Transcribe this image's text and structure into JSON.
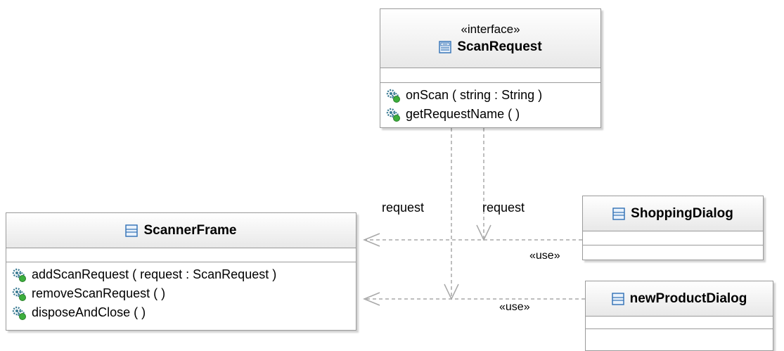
{
  "diagram": {
    "interface": {
      "stereotype": "«interface»",
      "name": "ScanRequest",
      "icon": "interface-icon",
      "operations": [
        "onScan ( string : String )",
        "getRequestName ( )"
      ]
    },
    "scanner_frame": {
      "name": "ScannerFrame",
      "icon": "class-icon",
      "operations": [
        "addScanRequest ( request : ScanRequest )",
        "removeScanRequest ( )",
        "disposeAndClose ( )"
      ]
    },
    "shopping_dialog": {
      "name": "ShoppingDialog",
      "icon": "class-icon"
    },
    "new_product_dialog": {
      "name": "newProductDialog",
      "icon": "class-icon"
    },
    "labels": {
      "request_left": "request",
      "request_right": "request",
      "use_top": "«use»",
      "use_bottom": "«use»"
    },
    "colors": {
      "border": "#9a9a9a",
      "header_gradient_end": "#e8e8e8",
      "class_icon": "#2f6fb5",
      "operation_icon": "#3c7c94",
      "operation_badge": "#3cae3c",
      "edge": "#a8a8a8"
    }
  }
}
